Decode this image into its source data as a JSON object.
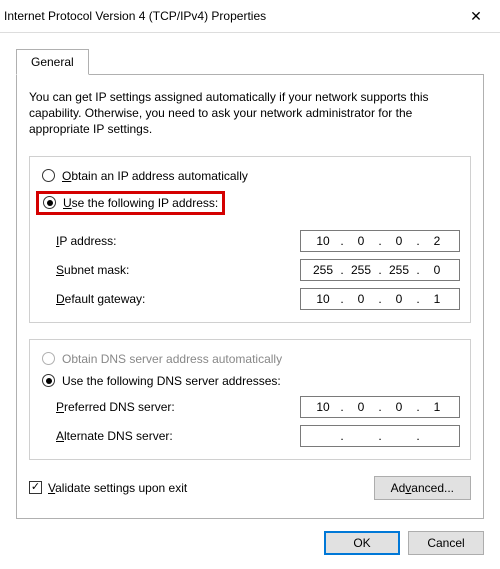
{
  "title": "Internet Protocol Version 4 (TCP/IPv4) Properties",
  "tab": "General",
  "intro": "You can get IP settings assigned automatically if your network supports this capability. Otherwise, you need to ask your network administrator for the appropriate IP settings.",
  "ip": {
    "auto_o": "O",
    "auto_rest": "btain an IP address automatically",
    "manual_u": "U",
    "manual_rest": "se the following IP address:",
    "addr_u": "I",
    "addr_rest": "P address:",
    "mask_u": "S",
    "mask_rest": "ubnet mask:",
    "gw_u": "D",
    "gw_rest": "efault gateway:",
    "addr": {
      "a": "10",
      "b": "0",
      "c": "0",
      "d": "2"
    },
    "mask": {
      "a": "255",
      "b": "255",
      "c": "255",
      "d": "0"
    },
    "gw": {
      "a": "10",
      "b": "0",
      "c": "0",
      "d": "1"
    }
  },
  "dns": {
    "auto_o": "O",
    "auto_rest": "btain DNS server address automatically",
    "manual_u": "U",
    "manual_rest": "se the following DNS server addresses:",
    "pref_u": "P",
    "pref_rest": "referred DNS server:",
    "alt_u": "A",
    "alt_rest": "lternate DNS server:",
    "pref": {
      "a": "10",
      "b": "0",
      "c": "0",
      "d": "1"
    },
    "alt": {
      "a": "",
      "b": "",
      "c": "",
      "d": ""
    }
  },
  "validate_u": "V",
  "validate_rest": "alidate settings upon exit",
  "advanced_u": "Ad",
  "advanced_rest": "v",
  "advanced_rest2": "anced...",
  "ok": "OK",
  "cancel": "Cancel",
  "dotsep": "."
}
